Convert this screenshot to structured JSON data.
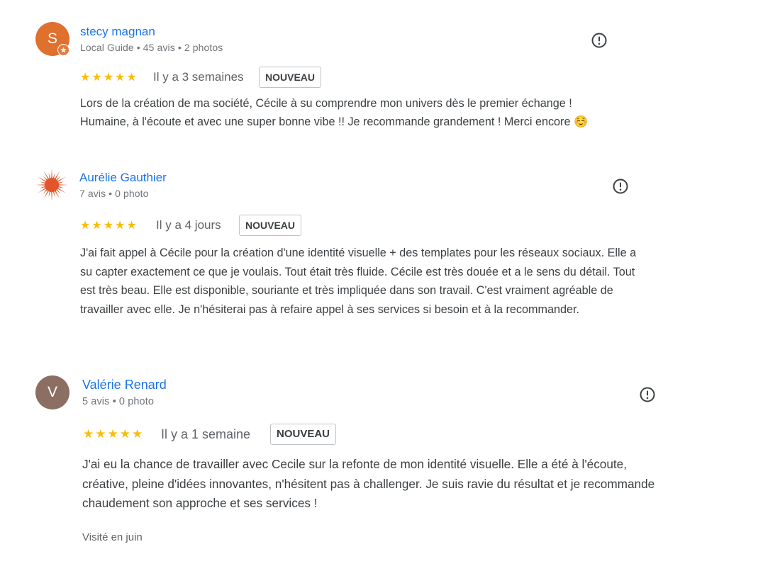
{
  "reviews": [
    {
      "name": "stecy magnan",
      "avatar_letter": "S",
      "avatar_color": "#e0702e",
      "meta": "Local Guide • 45 avis • 2 photos",
      "rating": "★★★★★",
      "date": "Il y a 3 semaines",
      "badge": "NOUVEAU",
      "text": "Lors de la création de ma société, Cécile à su comprendre mon univers dès le premier échange ! Humaine, à l'écoute et avec une super bonne vibe !! Je recommande grandement ! Merci encore ☺️"
    },
    {
      "name": "Aurélie Gauthier",
      "avatar_color": "#e2552c",
      "meta": "7 avis • 0 photo",
      "rating": "★★★★★",
      "date": "Il y a 4 jours",
      "badge": "NOUVEAU",
      "text": "J'ai fait appel à Cécile pour la création d'une identité visuelle + des templates pour les réseaux sociaux. Elle a su capter exactement ce que je voulais. Tout était très fluide. Cécile est très douée et a le sens du détail. Tout est très beau. Elle est disponible, souriante et très impliquée dans son travail. C'est vraiment agréable de travailler avec elle. Je n'hésiterai pas à refaire appel à ses services si besoin et à la recommander."
    },
    {
      "name": "Valérie Renard",
      "avatar_letter": "V",
      "avatar_color": "#8d6e63",
      "meta": "5 avis • 0 photo",
      "rating": "★★★★★",
      "date": "Il y a 1 semaine",
      "badge": "NOUVEAU",
      "text": "J'ai eu la chance de travailler avec Cecile sur la refonte de mon identité visuelle. Elle a été à l'écoute, créative, pleine d'idées innovantes, n'hésitent pas à challenger. Je suis ravie du résultat et je recommande chaudement son approche et ses services !",
      "visited": "Visité en juin"
    }
  ],
  "icons": {
    "flag": "exclamation-circle-icon",
    "local_guide": "star-badge-icon",
    "avatar_sun": "sunburst-avatar-icon"
  }
}
